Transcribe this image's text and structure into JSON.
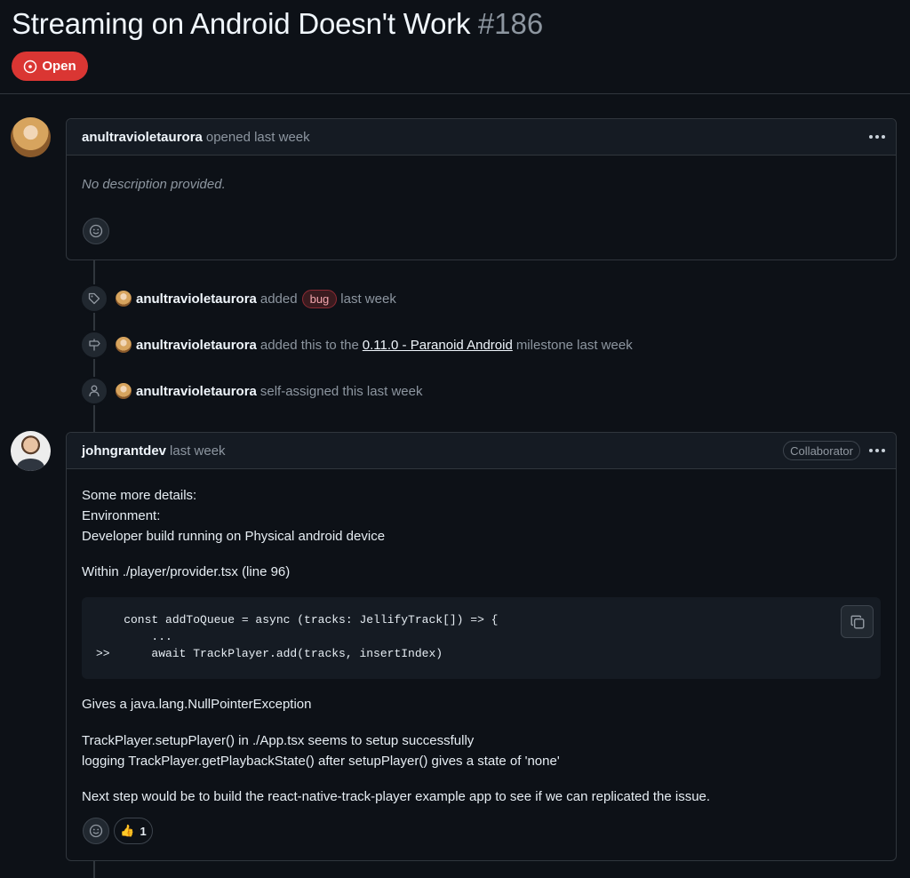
{
  "issue": {
    "title": "Streaming on Android Doesn't Work",
    "number": "#186",
    "state": "Open",
    "state_color": "#da3633"
  },
  "comment1": {
    "author": "anultravioletaurora",
    "meta": "opened last week",
    "body": "No description provided."
  },
  "events": [
    {
      "actor": "anultravioletaurora",
      "icon": "tag-icon",
      "text_before": "added",
      "label": "bug",
      "text_after": "last week"
    },
    {
      "actor": "anultravioletaurora",
      "icon": "milestone-icon",
      "text_before": "added this to the",
      "link": "0.11.0 - Paranoid Android",
      "text_after": "milestone last week"
    },
    {
      "actor": "anultravioletaurora",
      "icon": "person-icon",
      "text_before": "self-assigned this last week"
    }
  ],
  "comment2": {
    "author": "johngrantdev",
    "meta": "last week",
    "badge": "Collaborator",
    "lines": [
      "Some more details:",
      "Environment:",
      "Developer build running on Physical android device",
      "Within ./player/provider.tsx (line 96)"
    ],
    "code": [
      "    const addToQueue = async (tracks: JellifyTrack[]) => {",
      "        ...",
      ">>      await TrackPlayer.add(tracks, insertIndex)"
    ],
    "after_code": [
      "Gives a java.lang.NullPointerException",
      "TrackPlayer.setupPlayer() in ./App.tsx seems to setup successfully",
      "logging TrackPlayer.getPlaybackState() after setupPlayer() gives a state of 'none'",
      "Next step would be to build the react-native-track-player example app to see if we can replicated the issue."
    ],
    "reaction_count": "1"
  }
}
